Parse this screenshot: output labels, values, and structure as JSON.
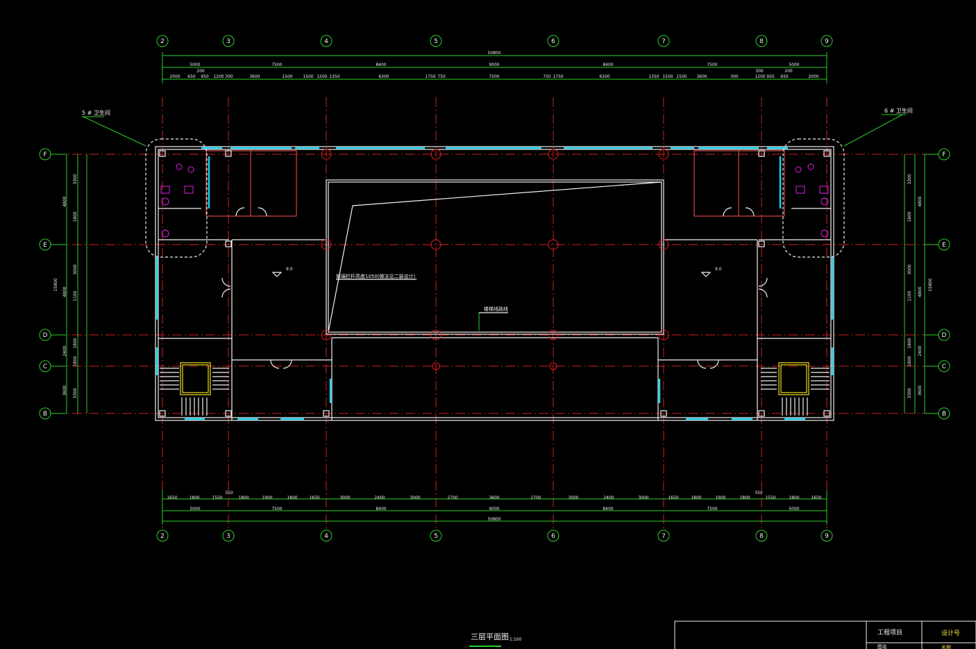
{
  "drawing": {
    "title": "三层平面图",
    "scale": "1:100",
    "axes_top": [
      "2",
      "3",
      "4",
      "5",
      "6",
      "7",
      "8",
      "9"
    ],
    "axes_side": [
      "F",
      "E",
      "D",
      "C",
      "B"
    ],
    "total_dim": "50800",
    "bay_dims": [
      "5000",
      "7500",
      "8400",
      "9000",
      "8400",
      "7500",
      "5000"
    ],
    "sub_dims_top": [
      "2000",
      "650",
      "950",
      "1200",
      "300",
      "3600",
      "1500",
      "1500",
      "1500",
      "1350",
      "6300",
      "1750",
      "750",
      "7500",
      "750",
      "1750",
      "6300",
      "1350",
      "1500",
      "1500",
      "3600",
      "300",
      "1200",
      "950",
      "650",
      "2000"
    ],
    "sub_dims_bottom": [
      "1650",
      "1800",
      "1550",
      "1800",
      "1900",
      "1800",
      "1650",
      "3000",
      "2400",
      "3000",
      "2700",
      "3600",
      "2700",
      "3000",
      "2400",
      "3000",
      "1650",
      "1800",
      "1900",
      "1800",
      "1550",
      "1800",
      "1650"
    ],
    "bottom_bays": [
      "5000",
      "7500",
      "8400",
      "9000",
      "8400",
      "7500",
      "5000"
    ],
    "note_350": "350",
    "note_200": "200",
    "note_300": "300",
    "left_toilet_label": "5 # 卫生间",
    "right_toilet_label": "6 # 卫生间",
    "railing_note": "玻璃栏杆高度1050(做法见二装设计)",
    "ceiling_note": "楼梯线路线",
    "level_left": "9.0",
    "level_right": "9.0",
    "side_dims": [
      "3300",
      "4800",
      "1800",
      "3000",
      "4800",
      "1100",
      "1800",
      "2400",
      "1800",
      "3600",
      "3300"
    ],
    "side_total": "15800",
    "title_block": {
      "project_label": "工程项目",
      "project_value": "设计号",
      "row2_label": "图名",
      "row2_value": "名称"
    }
  }
}
